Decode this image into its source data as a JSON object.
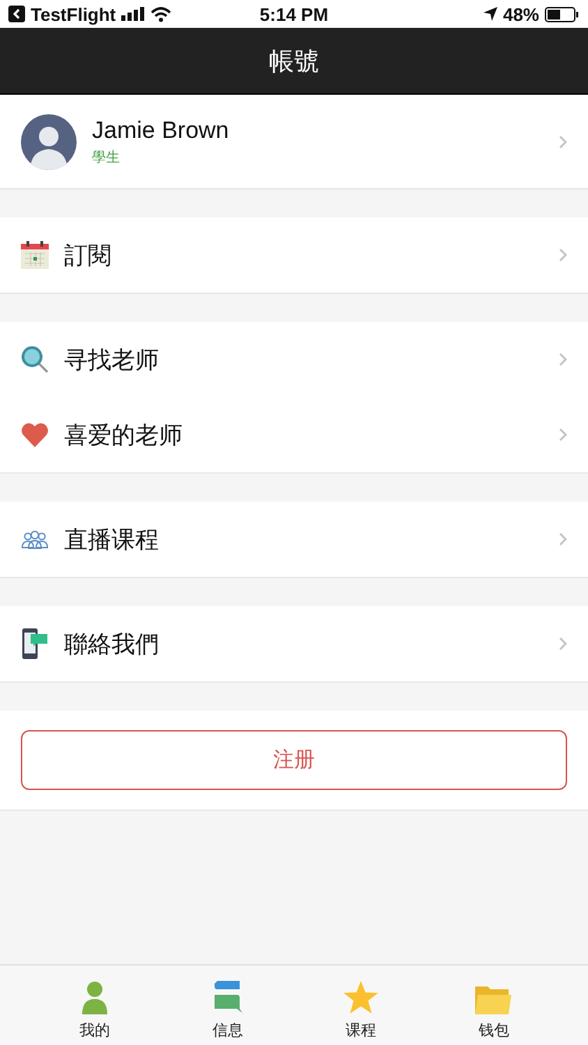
{
  "status_bar": {
    "back_app": "TestFlight",
    "time": "5:14 PM",
    "battery": "48%"
  },
  "header": {
    "title": "帳號"
  },
  "profile": {
    "name": "Jamie Brown",
    "role": "學生"
  },
  "sections": [
    {
      "items": [
        {
          "label": "訂閱",
          "kind": "calendar"
        }
      ]
    },
    {
      "items": [
        {
          "label": "寻找老师",
          "kind": "search"
        },
        {
          "label": "喜爱的老师",
          "kind": "heart"
        }
      ]
    },
    {
      "items": [
        {
          "label": "直播课程",
          "kind": "people"
        }
      ]
    },
    {
      "items": [
        {
          "label": "聯絡我們",
          "kind": "phone"
        }
      ]
    }
  ],
  "register_button": "注册",
  "tab_bar": [
    {
      "label": "我的",
      "kind": "person"
    },
    {
      "label": "信息",
      "kind": "chat"
    },
    {
      "label": "课程",
      "kind": "star"
    },
    {
      "label": "钱包",
      "kind": "folder"
    }
  ]
}
